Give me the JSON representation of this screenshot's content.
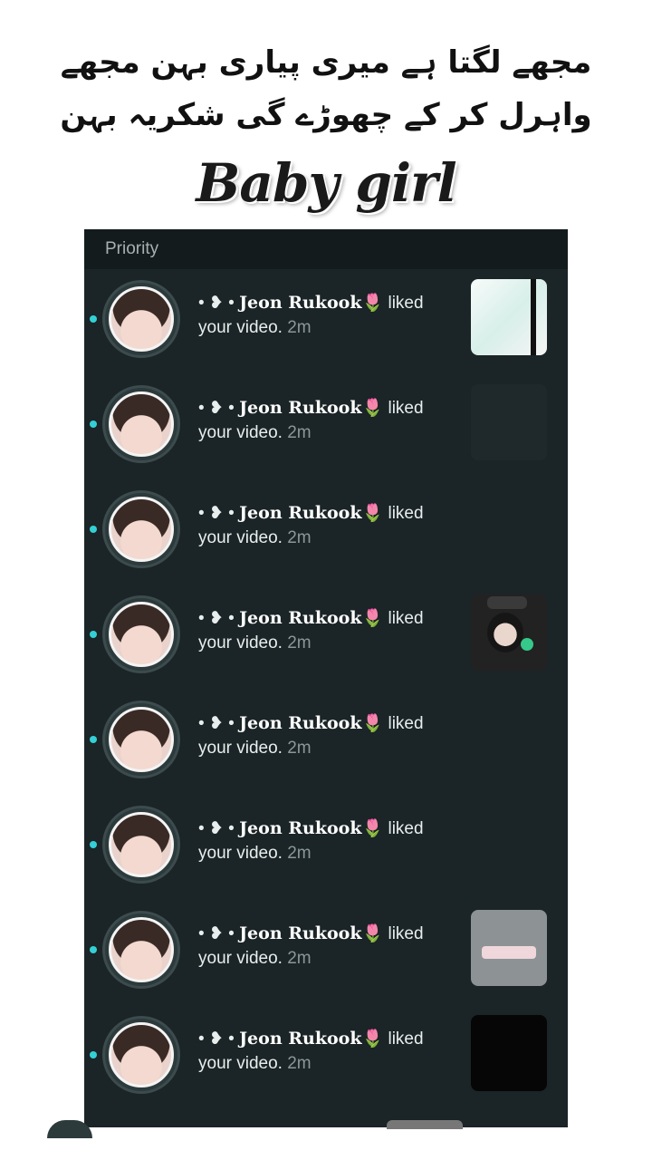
{
  "caption": {
    "line1": "مجھے لگتا ہے میری پیاری بہن مجھے",
    "line2": "واہرل کر کے چھوڑے گی شکریہ بہن"
  },
  "script_title": "Baby girl",
  "section_header": "Priority",
  "notifications": [
    {
      "prefix": "• ❥ • ",
      "username": "Jeon Rukook",
      "emoji": "🌷",
      "action": " liked your video.",
      "time": " 2m",
      "thumb": "chat-screenshot"
    },
    {
      "prefix": "• ❥ • ",
      "username": "Jeon Rukook",
      "emoji": "🌷",
      "action": " liked your video.",
      "time": " 2m",
      "thumb": "dark"
    },
    {
      "prefix": "• ❥ • ",
      "username": "Jeon Rukook",
      "emoji": "🌷",
      "action": " liked your video.",
      "time": " 2m",
      "thumb": "none"
    },
    {
      "prefix": "• ❥ • ",
      "username": "Jeon Rukook",
      "emoji": "🌷",
      "action": " liked your video.",
      "time": " 2m",
      "thumb": "person"
    },
    {
      "prefix": "• ❥ • ",
      "username": "Jeon Rukook",
      "emoji": "🌷",
      "action": " liked your video.",
      "time": " 2m",
      "thumb": "none"
    },
    {
      "prefix": "• ❥ • ",
      "username": "Jeon Rukook",
      "emoji": "🌷",
      "action": " liked your video.",
      "time": " 2m",
      "thumb": "none"
    },
    {
      "prefix": "• ❥ • ",
      "username": "Jeon Rukook",
      "emoji": "🌷",
      "action": " liked your video.",
      "time": " 2m",
      "thumb": "grey-card"
    },
    {
      "prefix": "• ❥ • ",
      "username": "Jeon Rukook",
      "emoji": "🌷",
      "action": " liked your video.",
      "time": " 2m",
      "thumb": "black-card"
    }
  ],
  "colors": {
    "background": "#1b2426",
    "unread_dot": "#33d0d6",
    "header_bg": "#141b1c"
  }
}
